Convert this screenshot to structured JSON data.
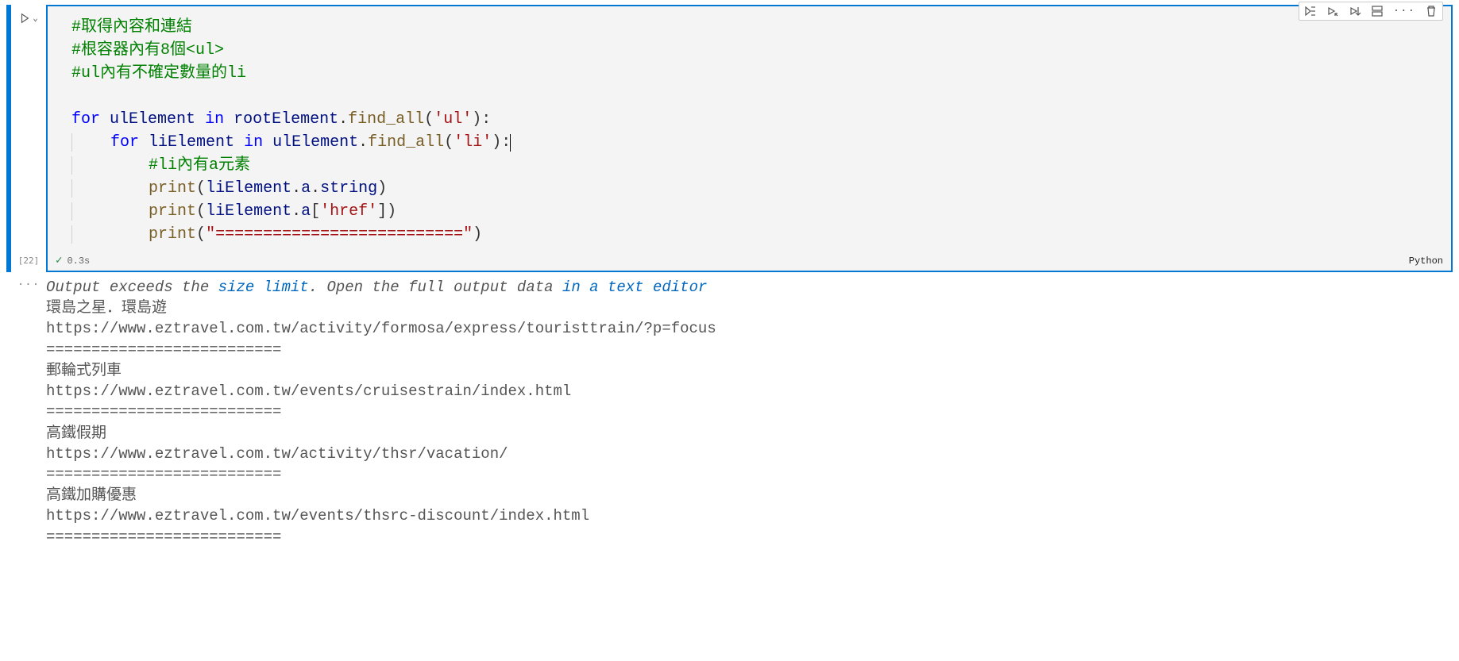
{
  "toolbar": {
    "run_by_line": "run-by-line",
    "execute_above": "execute-above",
    "execute_below": "execute-below",
    "split": "split-cell",
    "more": "···",
    "delete": "delete"
  },
  "cell": {
    "exec_count": "[22]",
    "duration": "0.3s",
    "language": "Python",
    "lines": {
      "c1": "#取得內容和連結",
      "c2": "#根容器內有8個<ul>",
      "c3": "#ul內有不確定數量的li",
      "kw_for1": "for",
      "id_ul": "ulElement",
      "kw_in1": "in",
      "id_root": "rootElement",
      "m_findall": "find_all",
      "s_ul": "'ul'",
      "kw_for2": "for",
      "id_li": "liElement",
      "kw_in2": "in",
      "s_li": "'li'",
      "c4": "#li內有a元素",
      "m_print": "print",
      "attr_a": "a",
      "attr_string": "string",
      "s_href": "'href'",
      "s_sep": "\"==========================\""
    }
  },
  "output": {
    "more_icon": "···",
    "exceed_prefix": "Output exceeds the ",
    "size_limit": "size limit",
    "exceed_mid": ". Open the full output data ",
    "text_editor": "in a text editor",
    "lines": [
      "環島之星．環島遊",
      "https://www.eztravel.com.tw/activity/formosa/express/touristtrain/?p=focus",
      "==========================",
      "郵輪式列車",
      "https://www.eztravel.com.tw/events/cruisestrain/index.html",
      "==========================",
      "高鐵假期",
      "https://www.eztravel.com.tw/activity/thsr/vacation/",
      "==========================",
      "高鐵加購優惠",
      "https://www.eztravel.com.tw/events/thsrc-discount/index.html",
      "=========================="
    ]
  }
}
